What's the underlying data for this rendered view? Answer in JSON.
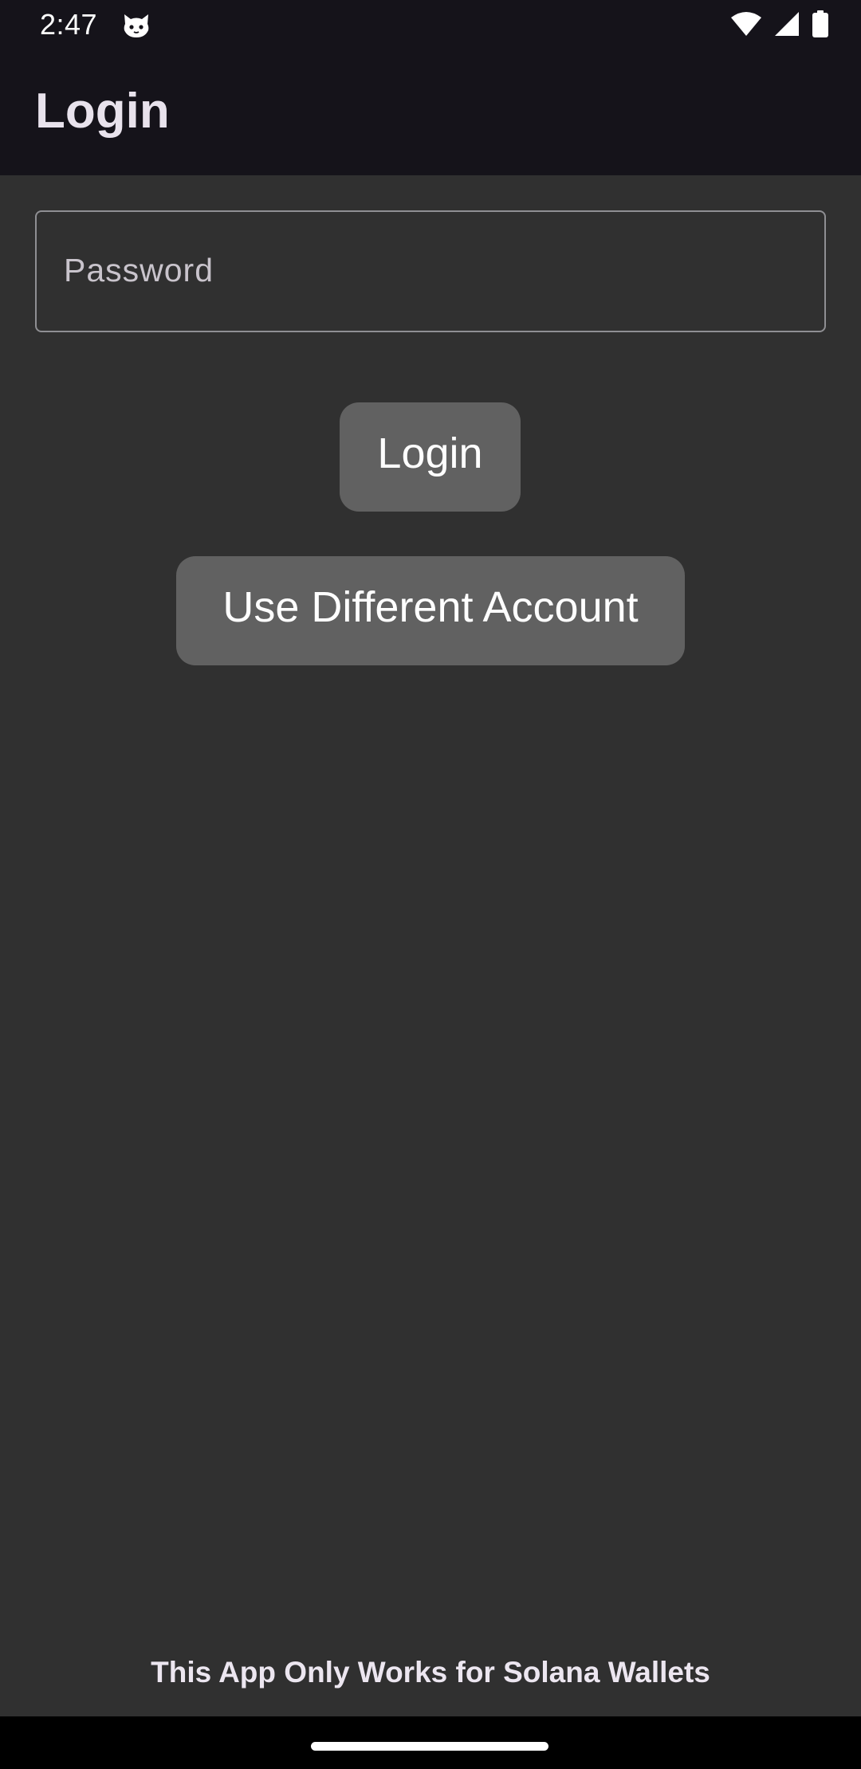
{
  "status_bar": {
    "time": "2:47",
    "notification_icon": "cat-face-icon",
    "icons": [
      "wifi-icon",
      "cell-signal-icon",
      "battery-icon"
    ]
  },
  "app_bar": {
    "title": "Login"
  },
  "form": {
    "password": {
      "value": "",
      "placeholder": "Password"
    },
    "login_label": "Login",
    "different_account_label": "Use Different Account"
  },
  "footer": {
    "note": "This App Only Works for Solana Wallets"
  },
  "colors": {
    "background": "#303030",
    "app_bar": "#15131a",
    "button": "#616161",
    "title_text": "#e8e2ec"
  }
}
